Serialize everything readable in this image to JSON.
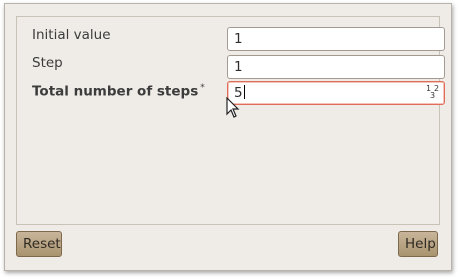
{
  "form": {
    "fields": [
      {
        "label": "Initial value",
        "value": "1",
        "required": false
      },
      {
        "label": "Step",
        "value": "1",
        "required": false
      },
      {
        "label": "Total number of steps",
        "value": "5",
        "required": true,
        "required_marker": "*"
      }
    ],
    "number_format_icon": {
      "icon": "numbers-icon",
      "glyphs": [
        "1",
        "2",
        "3"
      ]
    }
  },
  "buttons": {
    "reset_label": "Reset",
    "help_label": "Help"
  },
  "colors": {
    "window_bg": "#efebe7",
    "invalid_border": "#e06d5a",
    "button_bg": "#b8a382"
  }
}
